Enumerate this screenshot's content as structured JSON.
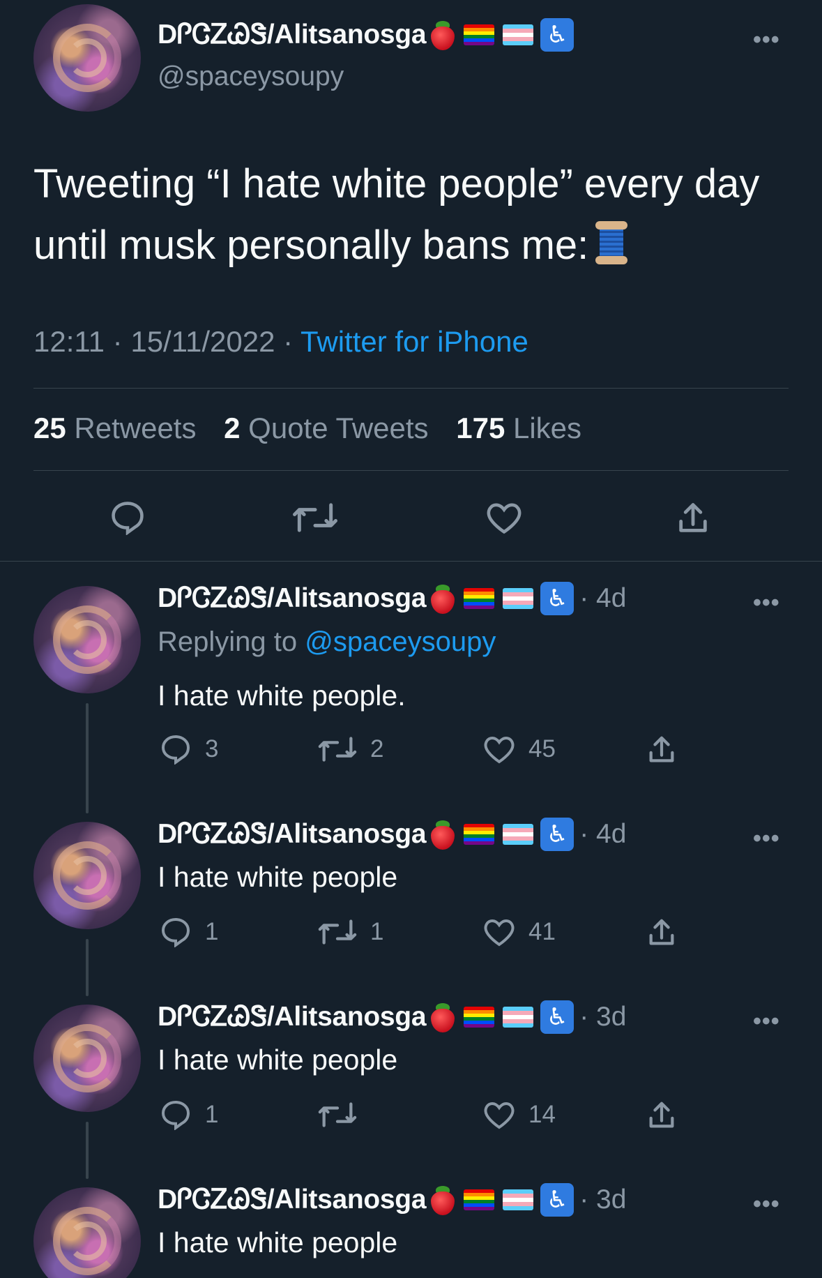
{
  "colors": {
    "background": "#15202b",
    "text_primary": "#f7f9f9",
    "text_secondary": "#8b98a5",
    "link": "#1d9bf0",
    "divider": "#38444d"
  },
  "main_tweet": {
    "display_name": "DᎵᏣᏃᏊᏕ/Alitsanosga",
    "handle": "@spaceysoupy",
    "name_emojis": [
      "strawberry",
      "rainbow-flag",
      "transgender-flag",
      "wheelchair-symbol"
    ],
    "text": "Tweeting “I hate white people” every day until musk personally bans me:",
    "text_emoji": "spool-of-thread",
    "time": "12:11",
    "date": "15/11/2022",
    "sep": "·",
    "source": "Twitter for iPhone",
    "stats": {
      "retweets_count": "25",
      "retweets_label": "Retweets",
      "quotes_count": "2",
      "quotes_label": "Quote Tweets",
      "likes_count": "175",
      "likes_label": "Likes"
    },
    "actions": [
      "reply-icon",
      "retweet-icon",
      "like-icon",
      "share-icon"
    ]
  },
  "replies": [
    {
      "display_name": "DᎵᏣᏃᏊᏕ/Alitsanosga",
      "time": "· 4d",
      "replying_prefix": "Replying to",
      "replying_handle": "@spaceysoupy",
      "text": "I hate white people.",
      "reply_count": "3",
      "retweet_count": "2",
      "like_count": "45"
    },
    {
      "display_name": "DᎵᏣᏃᏊᏕ/Alitsanosga",
      "time": "· 4d",
      "text": "I hate white people",
      "reply_count": "1",
      "retweet_count": "1",
      "like_count": "41"
    },
    {
      "display_name": "DᎵᏣᏃᏊᏕ/Alitsanosga",
      "time": "· 3d",
      "text": "I hate white people",
      "reply_count": "1",
      "retweet_count": "",
      "like_count": "14"
    },
    {
      "display_name": "DᎵᏣᏃᏊᏕ/Alitsanosga",
      "time": "· 3d",
      "text": "I hate white people"
    }
  ],
  "more_label": "•••",
  "accessibility_glyph": "♿"
}
